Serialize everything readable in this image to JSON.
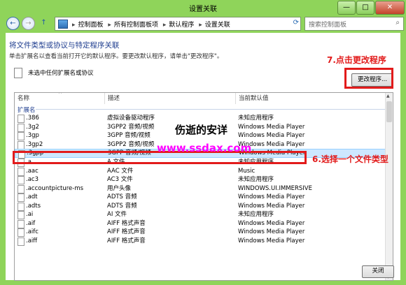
{
  "window": {
    "title": "设置关联",
    "min_label": "—",
    "max_label": "□",
    "close_label": "✕"
  },
  "nav": {
    "back_glyph": "←",
    "forward_glyph": "→",
    "up_glyph": "↑",
    "breadcrumbs": [
      "控制面板",
      "所有控制面板项",
      "默认程序",
      "设置关联"
    ],
    "search_placeholder": "搜索控制面板"
  },
  "page": {
    "heading": "将文件类型或协议与特定程序关联",
    "description": "单击扩展名以查看当前打开它的默认程序。要更改默认程序，请单击\"更改程序\"。",
    "no_selection": "未选中任何扩展名或协议",
    "change_button": "更改程序...",
    "close_button": "关闭"
  },
  "table": {
    "columns": [
      "名称",
      "描述",
      "当前默认值"
    ],
    "group": "扩展名",
    "rows": [
      {
        "ext": ".386",
        "desc": "虚拟设备驱动程序",
        "prog": "未知应用程序"
      },
      {
        "ext": ".3g2",
        "desc": "3GPP2 音频/视频",
        "prog": "Windows Media Player"
      },
      {
        "ext": ".3gp",
        "desc": "3GPP 音频/视频",
        "prog": "Windows Media Player"
      },
      {
        "ext": ".3gp2",
        "desc": "3GPP2 音频/视频",
        "prog": "Windows Media Player"
      },
      {
        "ext": ".3gpp",
        "desc": "3GPP 音频/视频",
        "prog": "Windows Media Player"
      },
      {
        "ext": ".a",
        "desc": "A 文件",
        "prog": "未知应用程序"
      },
      {
        "ext": ".aac",
        "desc": "AAC 文件",
        "prog": "Music"
      },
      {
        "ext": ".ac3",
        "desc": "AC3 文件",
        "prog": "未知应用程序"
      },
      {
        "ext": ".accountpicture-ms",
        "desc": "用户头像",
        "prog": "WINDOWS.UI.IMMERSIVE"
      },
      {
        "ext": ".adt",
        "desc": "ADTS 音频",
        "prog": "Windows Media Player"
      },
      {
        "ext": ".adts",
        "desc": "ADTS 音频",
        "prog": "Windows Media Player"
      },
      {
        "ext": ".ai",
        "desc": "AI 文件",
        "prog": "未知应用程序"
      },
      {
        "ext": ".aif",
        "desc": "AIFF 格式声音",
        "prog": "Windows Media Player"
      },
      {
        "ext": ".aifc",
        "desc": "AIFF 格式声音",
        "prog": "Windows Media Player"
      },
      {
        "ext": ".aiff",
        "desc": "AIFF 格式声音",
        "prog": "Windows Media Player"
      }
    ],
    "selected_index": 4
  },
  "annotations": {
    "step7": "7.点击更改程序",
    "step6": "6.选择一个文件类型",
    "watermark_text": "伤逝的安详",
    "watermark_url": "www.ssdax.com",
    "color": "#e21b1b"
  }
}
